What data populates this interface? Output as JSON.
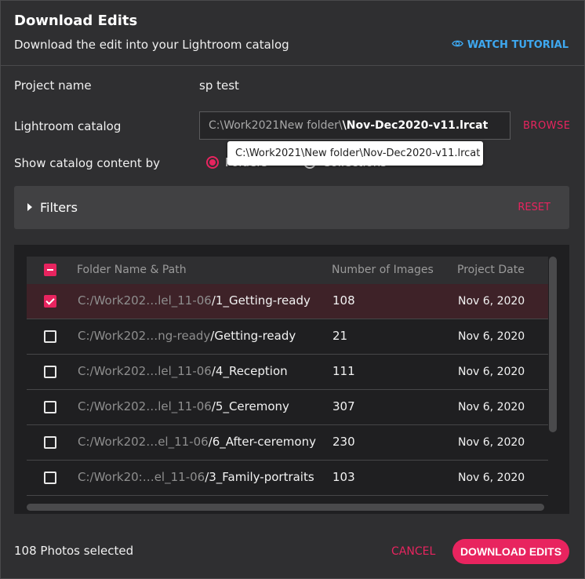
{
  "dialog": {
    "title": "Download Edits",
    "subtitle": "Download the edit into your Lightroom catalog",
    "watch_tutorial": "WATCH TUTORIAL"
  },
  "form": {
    "project_name_label": "Project name",
    "project_name_value": "sp test",
    "catalog_label": "Lightroom catalog",
    "catalog_path_dim": "C:\\Work2021New folder\\",
    "catalog_path_strong": "\\Nov-Dec2020-v11.lrcat",
    "browse": "BROWSE",
    "tooltip": "C:\\Work2021\\New folder\\Nov-Dec2020-v11.lrcat",
    "show_by_label": "Show catalog content by",
    "option_folders": "Folders",
    "option_collections": "Collections",
    "selected_option": "Folders"
  },
  "filters": {
    "label": "Filters",
    "reset": "RESET"
  },
  "table": {
    "columns": [
      "Folder Name & Path",
      "Number of Images",
      "Project Date"
    ],
    "rows": [
      {
        "path_dim": "C:/Work202…lel_11-06",
        "path_strong": "/1_Getting-ready",
        "images": "108",
        "date": "Nov 6, 2020",
        "checked": true
      },
      {
        "path_dim": "C:/Work202…ng-ready",
        "path_strong": "/Getting-ready",
        "images": "21",
        "date": "Nov 6, 2020",
        "checked": false
      },
      {
        "path_dim": "C:/Work202…lel_11-06",
        "path_strong": "/4_Reception",
        "images": "111",
        "date": "Nov 6, 2020",
        "checked": false
      },
      {
        "path_dim": "C:/Work202…lel_11-06",
        "path_strong": "/5_Ceremony",
        "images": "307",
        "date": "Nov 6, 2020",
        "checked": false
      },
      {
        "path_dim": "C:/Work202…el_11-06",
        "path_strong": "/6_After-ceremony",
        "images": "230",
        "date": "Nov 6, 2020",
        "checked": false
      },
      {
        "path_dim": "C:/Work20:…el_11-06",
        "path_strong": "/3_Family-portraits",
        "images": "103",
        "date": "Nov 6, 2020",
        "checked": false
      }
    ]
  },
  "footer": {
    "selected_text": "108 Photos selected",
    "cancel": "CANCEL",
    "download": "DOWNLOAD EDITS"
  },
  "colors": {
    "accent": "#e8245f",
    "link": "#3ea8f0",
    "background": "#2f2f31"
  }
}
